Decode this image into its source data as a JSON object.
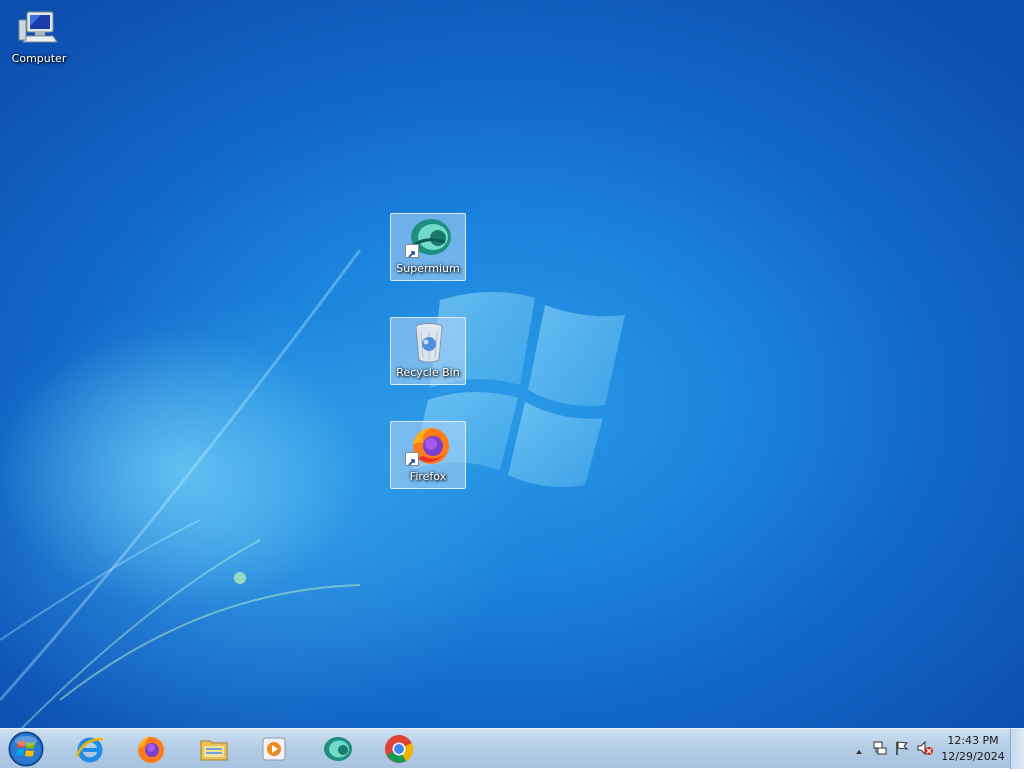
{
  "desktop": {
    "icons": [
      {
        "label": "Computer",
        "icon": "computer-icon"
      },
      {
        "label": "Supermium",
        "icon": "supermium-icon",
        "shortcut": true
      },
      {
        "label": "Recycle Bin",
        "icon": "recycle-bin-icon"
      },
      {
        "label": "Firefox",
        "icon": "firefox-icon",
        "shortcut": true
      }
    ]
  },
  "taskbar": {
    "start": {
      "icon": "windows-start-orb-icon"
    },
    "pinned": [
      {
        "icon": "internet-explorer-icon"
      },
      {
        "icon": "firefox-icon"
      },
      {
        "icon": "file-explorer-icon"
      },
      {
        "icon": "media-player-icon"
      },
      {
        "icon": "supermium-icon"
      },
      {
        "icon": "chrome-icon"
      }
    ],
    "tray": {
      "icons": [
        "show-hidden-icons-arrow",
        "network-icon",
        "action-center-flag-icon",
        "volume-muted-icon"
      ],
      "time": "12:43 PM",
      "date": "12/29/2024"
    }
  },
  "colors": {
    "desktop_blue": "#1b83dc",
    "taskbar": "#b4cde6"
  }
}
